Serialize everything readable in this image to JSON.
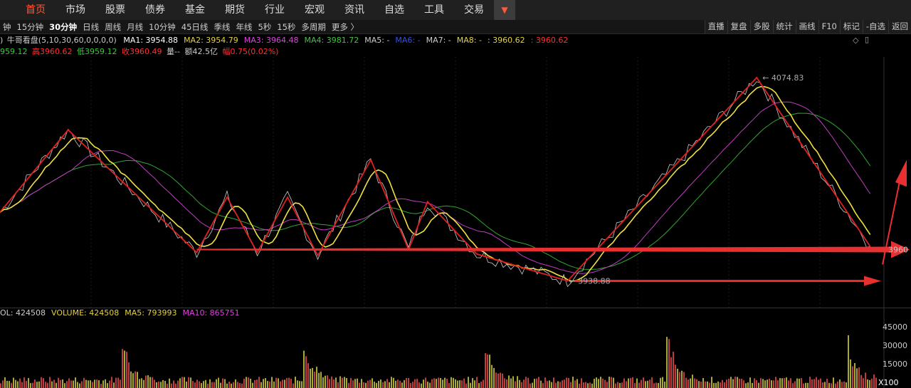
{
  "nav": {
    "items": [
      "首页",
      "市场",
      "股票",
      "债券",
      "基金",
      "期货",
      "行业",
      "宏观",
      "资讯",
      "自选",
      "工具",
      "交易"
    ],
    "active_index": 0,
    "dropdown_icon": "triangle-down-icon"
  },
  "periods": {
    "items": [
      "钟",
      "15分钟",
      "30分钟",
      "日线",
      "周线",
      "月线",
      "10分钟",
      "45日线",
      "季线",
      "年线",
      "5秒",
      "15秒",
      "多周期",
      "更多 〉"
    ],
    "active_index": 2
  },
  "tools": [
    "直播",
    "复盘",
    "多股",
    "统计",
    "画线",
    "F10",
    "标记",
    "-自选",
    "返回"
  ],
  "indicator": {
    "name": "牛哥看盘(5,10,30,60,0,0,0,0)",
    "lead": ")",
    "ma": [
      {
        "label": "MA1: 3954.88",
        "color": "#ffffff"
      },
      {
        "label": "MA2: 3954.79",
        "color": "#e6d23c"
      },
      {
        "label": "MA3: 3964.48",
        "color": "#e040e0"
      },
      {
        "label": "MA4: 3981.72",
        "color": "#3cc83c"
      },
      {
        "label": "MA5: -",
        "color": "#cccccc"
      },
      {
        "label": "MA6: -",
        "color": "#3050ff"
      },
      {
        "label": "MA7: -",
        "color": "#cccccc"
      },
      {
        "label": "MA8: -",
        "color": "#e6d23c"
      },
      {
        "label": ": 3960.62",
        "color": "#e6d23c"
      },
      {
        "label": ": 3960.62",
        "color": "#ff3030"
      }
    ]
  },
  "quote": {
    "open": "959.12",
    "high": "高3960.62",
    "low": "低3959.12",
    "close": "收3960.49",
    "vol": "量--",
    "amount": "额42.5亿",
    "change": "幅0.75(0.02%)"
  },
  "chart_data": {
    "type": "line",
    "annotations": {
      "high": "4074.83",
      "low": "3938.88",
      "price_label": "3960"
    },
    "zigzag": [
      {
        "i": 0,
        "v": 3985
      },
      {
        "i": 18,
        "v": 4040
      },
      {
        "i": 52,
        "v": 3958
      },
      {
        "i": 60,
        "v": 3995
      },
      {
        "i": 68,
        "v": 3958
      },
      {
        "i": 76,
        "v": 3995
      },
      {
        "i": 84,
        "v": 3956
      },
      {
        "i": 98,
        "v": 4020
      },
      {
        "i": 108,
        "v": 3960
      },
      {
        "i": 113,
        "v": 3992
      },
      {
        "i": 126,
        "v": 3957
      },
      {
        "i": 150,
        "v": 3939
      },
      {
        "i": 200,
        "v": 4075
      },
      {
        "i": 230,
        "v": 3962
      }
    ],
    "horizontal_levels": [
      3960,
      3939
    ],
    "volume": {
      "legend": [
        {
          "label": "OL: 424508",
          "color": "#cccccc"
        },
        {
          "label": "VOLUME: 424508",
          "color": "#e6d23c"
        },
        {
          "label": "MA5: 793993",
          "color": "#e6d23c"
        },
        {
          "label": "MA10: 865751",
          "color": "#e040e0"
        }
      ],
      "yticks": [
        "45000",
        "30000",
        "15000"
      ],
      "unit": "X100"
    }
  }
}
